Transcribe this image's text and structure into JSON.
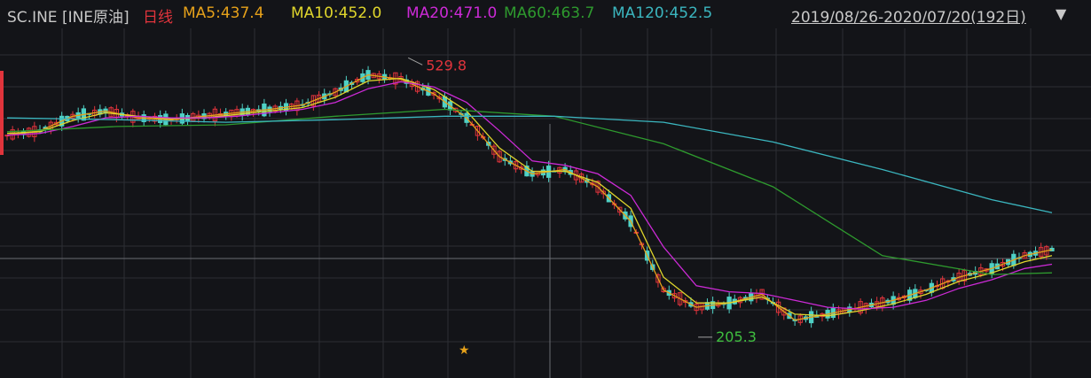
{
  "header": {
    "symbol": "SC.INE [INE原油]",
    "period": "日线",
    "ma5": "MA5:437.4",
    "ma10": "MA10:452.0",
    "ma20": "MA20:471.0",
    "ma60": "MA60:463.7",
    "ma120": "MA120:452.5",
    "range": "2019/08/26-2020/07/20(192日)",
    "dropdown_icon": "triangle-down-icon"
  },
  "colors": {
    "background": "#131418",
    "grid": "#2c2e34",
    "up": "#e0343c",
    "down": "#4fd1c5",
    "ma5": "#e6a11a",
    "ma10": "#e0d62c",
    "ma20": "#cc2ad6",
    "ma60": "#2e9a2e",
    "ma120": "#3bb6bf"
  },
  "chart_data": {
    "type": "line",
    "title": "SC.INE [INE原油] 日线",
    "x_range": [
      "2019/08/26",
      "2020/07/20"
    ],
    "bar_count": 192,
    "ylim": [
      165,
      560
    ],
    "annotations": [
      {
        "label": "529.8",
        "value": 529.8,
        "kind": "high"
      },
      {
        "label": "205.3",
        "value": 205.3,
        "kind": "low"
      }
    ],
    "marker": "★",
    "series": [
      {
        "name": "MA5",
        "last": 437.4,
        "x": [
          0,
          6,
          12,
          18,
          24,
          30,
          36,
          42,
          48,
          54,
          60,
          66,
          72,
          78,
          84,
          90,
          96,
          102,
          108,
          114,
          120,
          126,
          132,
          138,
          144,
          150,
          156,
          162,
          168,
          174,
          180,
          186,
          191
        ],
        "values": [
          440,
          445,
          462,
          468,
          460,
          458,
          462,
          466,
          470,
          475,
          490,
          510,
          505,
          488,
          460,
          415,
          395,
          400,
          380,
          340,
          260,
          240,
          245,
          255,
          225,
          232,
          240,
          248,
          260,
          275,
          285,
          300,
          307
        ]
      },
      {
        "name": "MA10",
        "last": 452.0,
        "x": [
          0,
          6,
          12,
          18,
          24,
          30,
          36,
          42,
          48,
          54,
          60,
          66,
          72,
          78,
          84,
          90,
          96,
          102,
          108,
          114,
          120,
          126,
          132,
          138,
          144,
          150,
          156,
          162,
          168,
          174,
          180,
          186,
          191
        ],
        "values": [
          442,
          444,
          457,
          466,
          462,
          459,
          460,
          464,
          468,
          472,
          484,
          503,
          506,
          493,
          468,
          425,
          398,
          398,
          385,
          355,
          275,
          245,
          245,
          252,
          232,
          230,
          236,
          244,
          255,
          270,
          280,
          293,
          300
        ]
      },
      {
        "name": "MA20",
        "last": 471.0,
        "x": [
          0,
          6,
          12,
          18,
          24,
          30,
          36,
          42,
          48,
          54,
          60,
          66,
          72,
          78,
          84,
          90,
          96,
          102,
          108,
          114,
          120,
          126,
          132,
          138,
          144,
          150,
          156,
          162,
          168,
          174,
          180,
          186,
          191
        ],
        "values": [
          440,
          442,
          450,
          460,
          462,
          460,
          460,
          462,
          466,
          470,
          478,
          494,
          502,
          496,
          478,
          445,
          410,
          405,
          395,
          370,
          310,
          265,
          258,
          256,
          248,
          240,
          238,
          240,
          248,
          262,
          272,
          285,
          290
        ]
      },
      {
        "name": "MA60",
        "last": 463.7,
        "x": [
          0,
          20,
          40,
          60,
          80,
          100,
          120,
          140,
          160,
          180,
          191
        ],
        "values": [
          444,
          450,
          452,
          462,
          470,
          462,
          430,
          380,
          300,
          278,
          280
        ]
      },
      {
        "name": "MA120",
        "last": 452.5,
        "x": [
          0,
          20,
          40,
          60,
          80,
          100,
          120,
          140,
          160,
          180,
          191
        ],
        "values": [
          460,
          458,
          455,
          458,
          462,
          462,
          455,
          432,
          400,
          365,
          350
        ]
      }
    ]
  }
}
